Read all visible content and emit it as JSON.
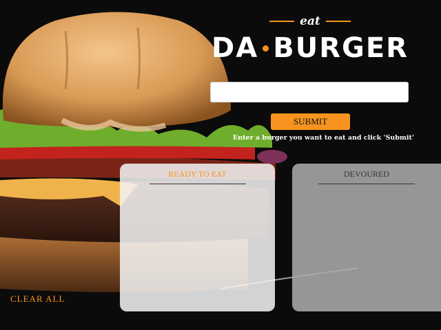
{
  "header": {
    "eat_label": "eat",
    "logo_left": "DA",
    "logo_right": "BURGER"
  },
  "form": {
    "input_value": "",
    "input_placeholder": "",
    "submit_label": "SUBMIT",
    "instructions": "Enter a burger you want to eat and click 'Submit'"
  },
  "panels": {
    "ready_title": "READY TO EAT",
    "devoured_title": "DEVOURED"
  },
  "actions": {
    "clear_all_label": "CLEAR ALL"
  },
  "colors": {
    "accent": "#f7931e",
    "background": "#0a0a0a",
    "ready_panel": "#f5f5f5",
    "devoured_panel": "#aaaaaa"
  },
  "icons": {
    "logo_separator": "orange-dot"
  }
}
